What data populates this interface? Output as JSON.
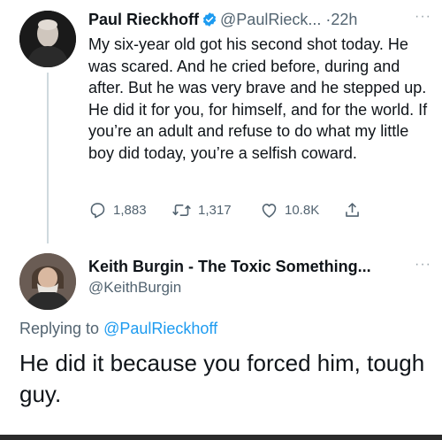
{
  "tweet": {
    "author_name": "Paul Rieckhoff",
    "handle": "@PaulRieck...",
    "separator": "·",
    "time": "22h",
    "more": "···",
    "text": "My six-year old got his second shot today. He was scared. And he cried before, during and after. But he was very brave and he stepped up. He did it for you, for himself, and for the world. If you’re an adult and refuse to do what my little boy did today, you’re a selfish coward.",
    "actions": {
      "replies": "1,883",
      "retweets": "1,317",
      "likes": "10.8K"
    },
    "icons": [
      "verified-icon",
      "reply-icon",
      "retweet-icon",
      "like-icon",
      "share-icon"
    ],
    "accent_color": "#1d9bf0"
  },
  "reply": {
    "author_name": "Keith Burgin - The Toxic Something...",
    "handle": "@KeithBurgin",
    "more": "···",
    "replying_prefix": "Replying to",
    "replying_to": "@PaulRieckhoff",
    "text": "He did it because you forced him, tough guy."
  }
}
